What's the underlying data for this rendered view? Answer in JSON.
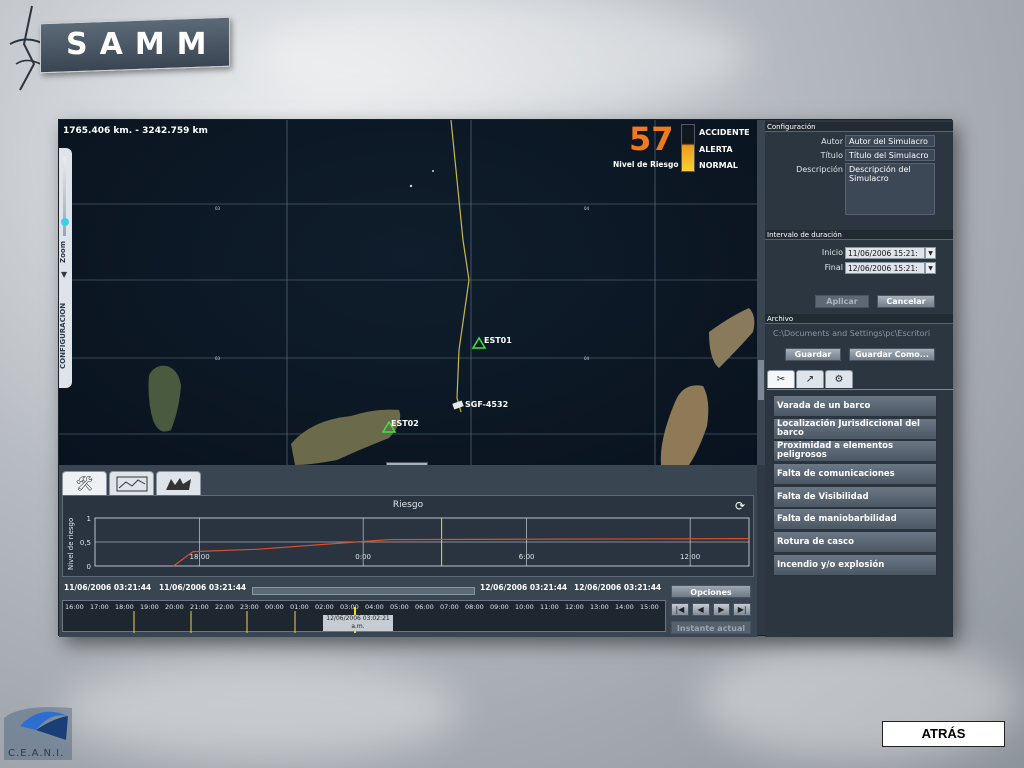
{
  "branding": {
    "title": "SAMM",
    "footer_logo": "C.E.A.N.I.",
    "back_label": "ATRÁS"
  },
  "map": {
    "coordinates": "1765.406 km. - 3242.759 km",
    "risk_value": "57",
    "risk_label": "Nivel de Riesgo",
    "risk_levels": [
      "ACCIDENTE",
      "ALERTA",
      "NORMAL"
    ],
    "zoom_label": "Zoom",
    "config_label": "CONFIGURACION",
    "markers": [
      {
        "label": "EST01"
      },
      {
        "label": "SGF-4532"
      },
      {
        "label": "EST02"
      }
    ],
    "grid_labels": [
      "03",
      "03",
      "04"
    ]
  },
  "chart": {
    "title": "Riesgo",
    "ylabel": "Nivel de riesgo",
    "yticks": [
      "1",
      "0,5",
      "0"
    ],
    "xticks": [
      "18:00",
      "0:00",
      "6:00",
      "12:00"
    ]
  },
  "chart_data": {
    "type": "line",
    "title": "Riesgo",
    "ylabel": "Nivel de riesgo",
    "xlabel": "",
    "categories": [
      "18:00",
      "0:00",
      "6:00",
      "12:00"
    ],
    "ylim": [
      0,
      1
    ],
    "series": [
      {
        "x": [
          0.12,
          0.15,
          0.25,
          0.35,
          0.45,
          1.0
        ],
        "values": [
          0,
          0.3,
          0.35,
          0.45,
          0.55,
          0.57
        ]
      }
    ]
  },
  "timeline": {
    "start_a": "11/06/2006 03:21:44",
    "start_b": "11/06/2006 03:21:44",
    "end_a": "12/06/2006 03:21:44",
    "end_b": "12/06/2006 03:21:44",
    "hours": [
      "16:00",
      "17:00",
      "18:00",
      "19:00",
      "20:00",
      "21:00",
      "22:00",
      "23:00",
      "00:00",
      "01:00",
      "02:00",
      "03:00",
      "04:00",
      "05:00",
      "06:00",
      "07:00",
      "08:00",
      "09:00",
      "10:00",
      "11:00",
      "12:00",
      "13:00",
      "14:00",
      "15:00"
    ],
    "tooltip_line1": "12/06/2006 03:02:21",
    "tooltip_line2": "a.m.",
    "options_label": "Opciones",
    "transport": [
      "|◀",
      "◀",
      "▶",
      "▶|"
    ],
    "current_instant_label": "Instante actual"
  },
  "config": {
    "section_label": "Configuración",
    "author_label": "Autor",
    "author_value": "Autor del Simulacro",
    "title_label": "Título",
    "title_value": "Título del Simulacro",
    "desc_label": "Descripción",
    "desc_value": "Descripción del Simulacro"
  },
  "interval": {
    "section_label": "Intervalo de duración",
    "start_label": "Inicio",
    "start_value": "11/06/2006 15:21:",
    "end_label": "Final",
    "end_value": "12/06/2006 15:21:",
    "apply_label": "Aplicar",
    "cancel_label": "Cancelar"
  },
  "file": {
    "section_label": "Archivo",
    "path": "C:\\Documents and Settings\\pc\\Escritori",
    "save_label": "Guardar",
    "save_as_label": "Guardar Como..."
  },
  "incidents": [
    "Varada de un barco",
    "Localización Jurisdiccional del barco",
    "Proximidad a elementos peligrosos",
    "Falta de comunicaciones",
    "Falta de Visibilidad",
    "Falta de maniobarbilidad",
    "Rotura de casco",
    "Incendio y/o explosión"
  ],
  "colors": {
    "accent": "#f07a1d",
    "track": "#c9b84a",
    "grid": "#8fa3b7"
  }
}
